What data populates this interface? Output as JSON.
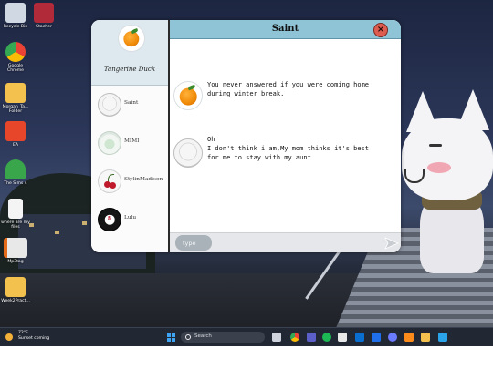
{
  "desktop": {
    "icons": [
      {
        "label": "Recycle Bin",
        "name": "recycle-bin-icon",
        "color": "#cfd8e3"
      },
      {
        "label": "Stacher",
        "name": "stacher-icon",
        "color": "#b12a3a"
      },
      {
        "label": "Google Chrome",
        "name": "chrome-icon",
        "color": "#34a853"
      },
      {
        "label": "Morgan_Ta... Folder",
        "name": "folder-icon",
        "color": "#f2c14e"
      },
      {
        "label": "EA",
        "name": "ea-icon",
        "color": "#e8462a"
      },
      {
        "label": "The Sims 4",
        "name": "sims-icon",
        "color": "#3aa64b"
      },
      {
        "label": "where are my files",
        "name": "document-icon",
        "color": "#f4f4f4"
      },
      {
        "label": "Mp3tag",
        "name": "mp3tag-icon",
        "color": "#e8e8e8"
      },
      {
        "label": "Week2Pract...",
        "name": "folder-icon-2",
        "color": "#f2c14e"
      }
    ]
  },
  "chat": {
    "profile": {
      "name": "Tangerine Duck"
    },
    "contacts": [
      {
        "name": "Saint"
      },
      {
        "name": "MIMI"
      },
      {
        "name": "StylinMadison"
      },
      {
        "name": "Lulu"
      }
    ],
    "header": {
      "title": "Saint",
      "close": "×"
    },
    "messages": [
      {
        "text": "You never answered if you were coming home\nduring winter break."
      },
      {
        "text": "Oh\nI don't think i am,My mom thinks it's best\nfor me to stay with my aunt"
      }
    ],
    "input": {
      "placeholder": "type",
      "value": ""
    }
  },
  "taskbar": {
    "weather": {
      "temp": "72°F",
      "condition": "Sunset coming"
    },
    "search": {
      "placeholder": "Search"
    },
    "colors": {
      "accent": "#3fa4f3"
    }
  }
}
